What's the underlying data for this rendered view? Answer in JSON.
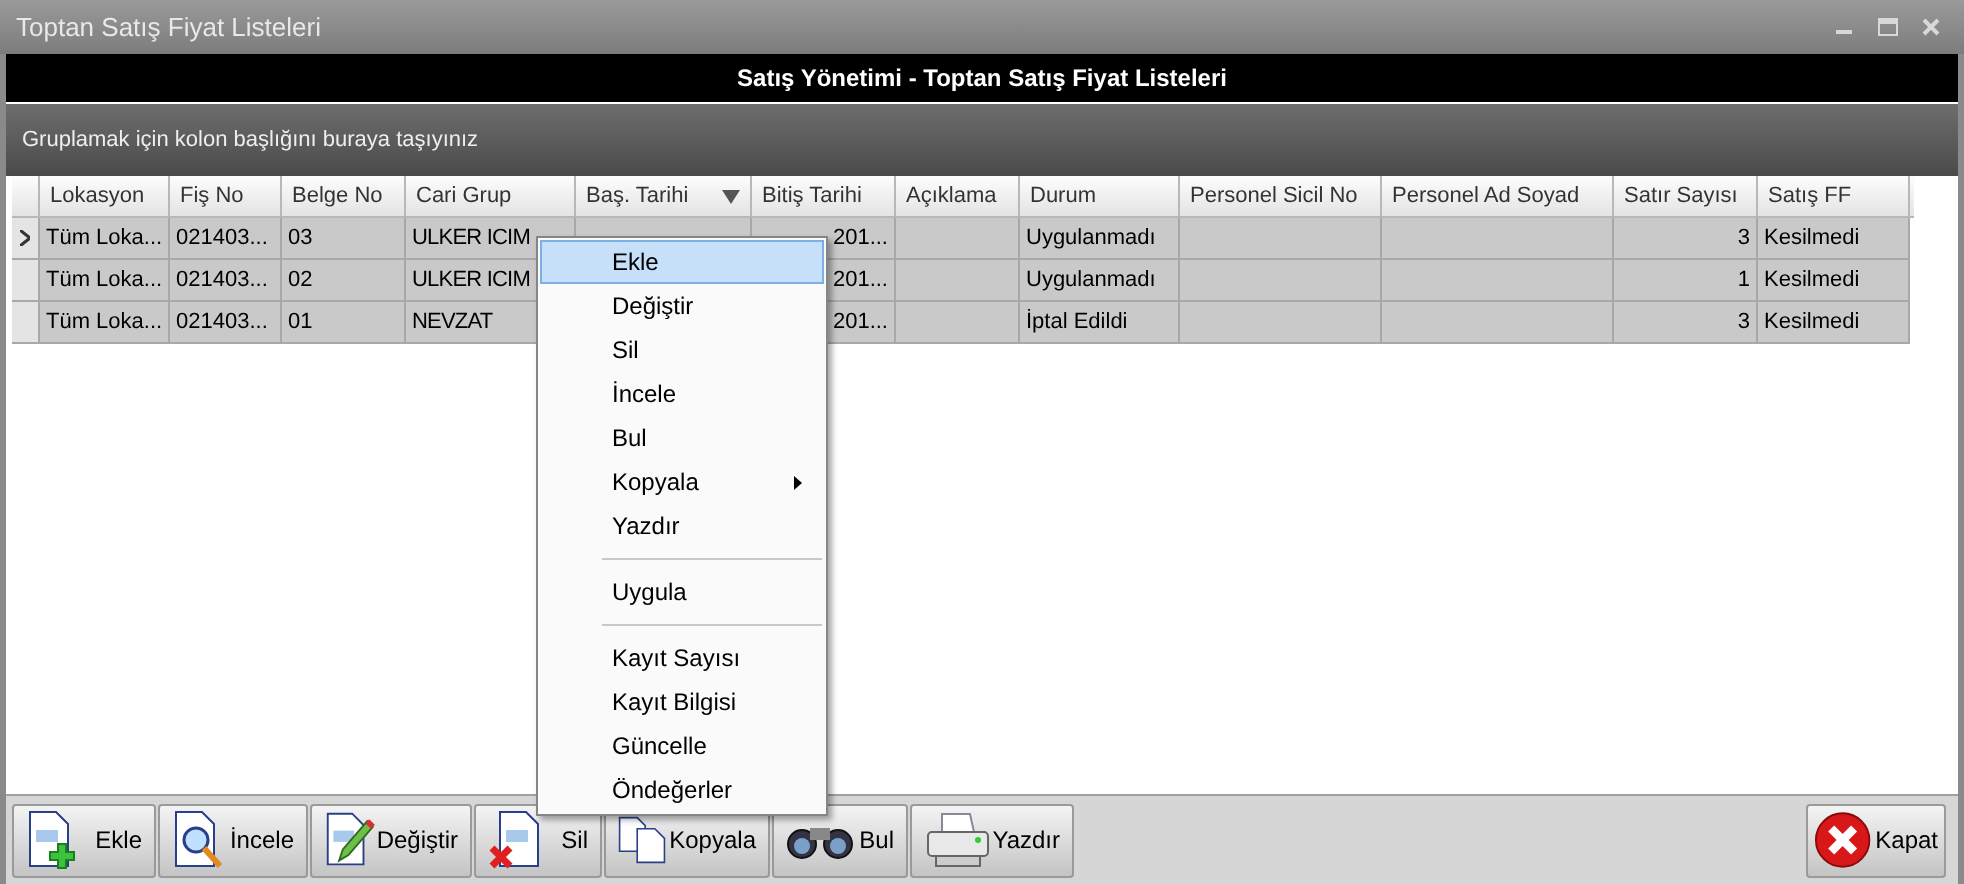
{
  "window": {
    "title": "Toptan Satış Fiyat Listeleri"
  },
  "header": {
    "title": "Satış Yönetimi - Toptan Satış Fiyat Listeleri"
  },
  "group_panel": {
    "text": "Gruplamak için kolon başlığını buraya taşıyınız"
  },
  "table": {
    "columns": [
      {
        "label": "Lokasyon",
        "kind": "text"
      },
      {
        "label": "Fiş No",
        "kind": "text"
      },
      {
        "label": "Belge No",
        "kind": "text"
      },
      {
        "label": "Cari Grup",
        "kind": "text"
      },
      {
        "label": "Baş. Tarihi",
        "kind": "text",
        "sorted": true
      },
      {
        "label": "Bitiş Tarihi",
        "kind": "text"
      },
      {
        "label": "Açıklama",
        "kind": "text"
      },
      {
        "label": "Durum",
        "kind": "text"
      },
      {
        "label": "Personel Sicil No",
        "kind": "text"
      },
      {
        "label": "Personel Ad Soyad",
        "kind": "text"
      },
      {
        "label": "Satır Sayısı",
        "kind": "number"
      },
      {
        "label": "Satış FF",
        "kind": "text"
      }
    ],
    "rows": [
      {
        "current": true,
        "cells": [
          "Tüm Loka...",
          "021403...",
          "03",
          "ULKER ICIM",
          null,
          "201...",
          null,
          "Uygulanmadı",
          null,
          null,
          "3",
          "Kesilmedi"
        ]
      },
      {
        "current": false,
        "cells": [
          "Tüm Loka...",
          "021403...",
          "02",
          "ULKER ICIM",
          null,
          "201...",
          null,
          "Uygulanmadı",
          null,
          null,
          "1",
          "Kesilmedi"
        ]
      },
      {
        "current": false,
        "cells": [
          "Tüm Loka...",
          "021403...",
          "01",
          "NEVZAT",
          null,
          "201...",
          null,
          "İptal Edildi",
          null,
          null,
          "3",
          "Kesilmedi"
        ]
      }
    ]
  },
  "context_menu": {
    "items": [
      {
        "kind": "item",
        "label": "Ekle",
        "selected": true,
        "submenu": false
      },
      {
        "kind": "item",
        "label": "Değiştir",
        "selected": false,
        "submenu": false
      },
      {
        "kind": "item",
        "label": "Sil",
        "selected": false,
        "submenu": false
      },
      {
        "kind": "item",
        "label": "İncele",
        "selected": false,
        "submenu": false
      },
      {
        "kind": "item",
        "label": "Bul",
        "selected": false,
        "submenu": false
      },
      {
        "kind": "item",
        "label": "Kopyala",
        "selected": false,
        "submenu": true
      },
      {
        "kind": "item",
        "label": "Yazdır",
        "selected": false,
        "submenu": false
      },
      {
        "kind": "separator"
      },
      {
        "kind": "item",
        "label": "Uygula",
        "selected": false,
        "submenu": false
      },
      {
        "kind": "separator"
      },
      {
        "kind": "item",
        "label": "Kayıt Sayısı",
        "selected": false,
        "submenu": false
      },
      {
        "kind": "item",
        "label": "Kayıt Bilgisi",
        "selected": false,
        "submenu": false
      },
      {
        "kind": "item",
        "label": "Güncelle",
        "selected": false,
        "submenu": false
      },
      {
        "kind": "item",
        "label": "Öndeğerler",
        "selected": false,
        "submenu": false
      }
    ]
  },
  "toolbar": {
    "buttons": [
      {
        "kind": "add",
        "label": "Ekle"
      },
      {
        "kind": "inspect",
        "label": "İncele"
      },
      {
        "kind": "edit",
        "label": "Değiştir"
      },
      {
        "kind": "delete",
        "label": "Sil"
      },
      {
        "kind": "copy",
        "label": "Kopyala"
      },
      {
        "kind": "find",
        "label": "Bul"
      },
      {
        "kind": "print",
        "label": "Yazdır"
      }
    ],
    "close_button": {
      "label": "Kapat"
    }
  }
}
